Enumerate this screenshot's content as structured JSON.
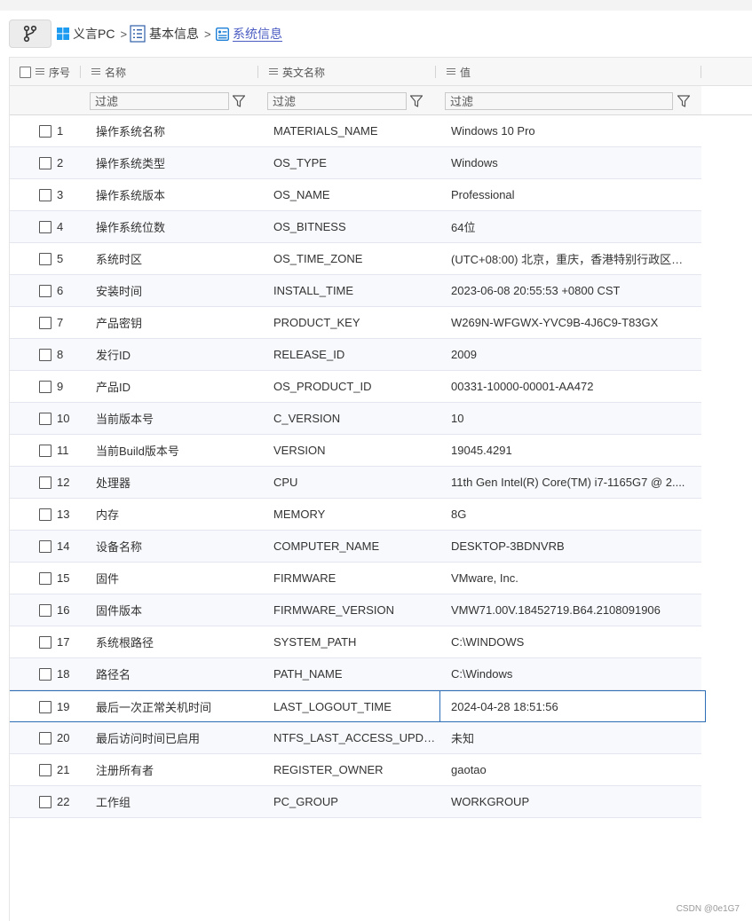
{
  "breadcrumb": {
    "items": [
      {
        "label": "义言PC",
        "icon": "windows-icon"
      },
      {
        "label": "基本信息",
        "icon": "list-doc-icon"
      },
      {
        "label": "系统信息",
        "icon": "info-card-icon"
      }
    ],
    "separator": ">"
  },
  "columns": {
    "index": "序号",
    "name": "名称",
    "english_name": "英文名称",
    "value": "值"
  },
  "filter": {
    "placeholder": "过滤"
  },
  "rows": [
    {
      "index": "1",
      "name": "操作系统名称",
      "en": "MATERIALS_NAME",
      "value": "Windows 10 Pro"
    },
    {
      "index": "2",
      "name": "操作系统类型",
      "en": "OS_TYPE",
      "value": "Windows"
    },
    {
      "index": "3",
      "name": "操作系统版本",
      "en": "OS_NAME",
      "value": "Professional"
    },
    {
      "index": "4",
      "name": "操作系统位数",
      "en": "OS_BITNESS",
      "value": "64位"
    },
    {
      "index": "5",
      "name": "系统时区",
      "en": "OS_TIME_ZONE",
      "value": "(UTC+08:00) 北京，重庆，香港特别行政区…"
    },
    {
      "index": "6",
      "name": "安装时间",
      "en": "INSTALL_TIME",
      "value": "2023-06-08 20:55:53 +0800 CST"
    },
    {
      "index": "7",
      "name": "产品密钥",
      "en": "PRODUCT_KEY",
      "value": "W269N-WFGWX-YVC9B-4J6C9-T83GX"
    },
    {
      "index": "8",
      "name": "发行ID",
      "en": "RELEASE_ID",
      "value": "2009"
    },
    {
      "index": "9",
      "name": "产品ID",
      "en": "OS_PRODUCT_ID",
      "value": "00331-10000-00001-AA472"
    },
    {
      "index": "10",
      "name": "当前版本号",
      "en": "C_VERSION",
      "value": "10"
    },
    {
      "index": "11",
      "name": "当前Build版本号",
      "en": "VERSION",
      "value": "19045.4291"
    },
    {
      "index": "12",
      "name": "处理器",
      "en": "CPU",
      "value": "11th Gen Intel(R) Core(TM) i7-1165G7 @ 2...."
    },
    {
      "index": "13",
      "name": "内存",
      "en": "MEMORY",
      "value": "8G"
    },
    {
      "index": "14",
      "name": "设备名称",
      "en": "COMPUTER_NAME",
      "value": "DESKTOP-3BDNVRB"
    },
    {
      "index": "15",
      "name": "固件",
      "en": "FIRMWARE",
      "value": "VMware, Inc."
    },
    {
      "index": "16",
      "name": "固件版本",
      "en": "FIRMWARE_VERSION",
      "value": "VMW71.00V.18452719.B64.2108091906"
    },
    {
      "index": "17",
      "name": "系统根路径",
      "en": "SYSTEM_PATH",
      "value": "C:\\WINDOWS"
    },
    {
      "index": "18",
      "name": "路径名",
      "en": "PATH_NAME",
      "value": "C:\\Windows"
    },
    {
      "index": "19",
      "name": "最后一次正常关机时间",
      "en": "LAST_LOGOUT_TIME",
      "value": "2024-04-28 18:51:56"
    },
    {
      "index": "20",
      "name": "最后访问时间已启用",
      "en": "NTFS_LAST_ACCESS_UPDA...",
      "value": "未知"
    },
    {
      "index": "21",
      "name": "注册所有者",
      "en": "REGISTER_OWNER",
      "value": "gaotao"
    },
    {
      "index": "22",
      "name": "工作组",
      "en": "PC_GROUP",
      "value": "WORKGROUP"
    }
  ],
  "selected_row_index": 18,
  "watermark": "CSDN @0e1G7",
  "colors": {
    "accent": "#2d6db5",
    "active_crumb": "#4a5cc2",
    "windows_blue": "#1d9bf0"
  }
}
